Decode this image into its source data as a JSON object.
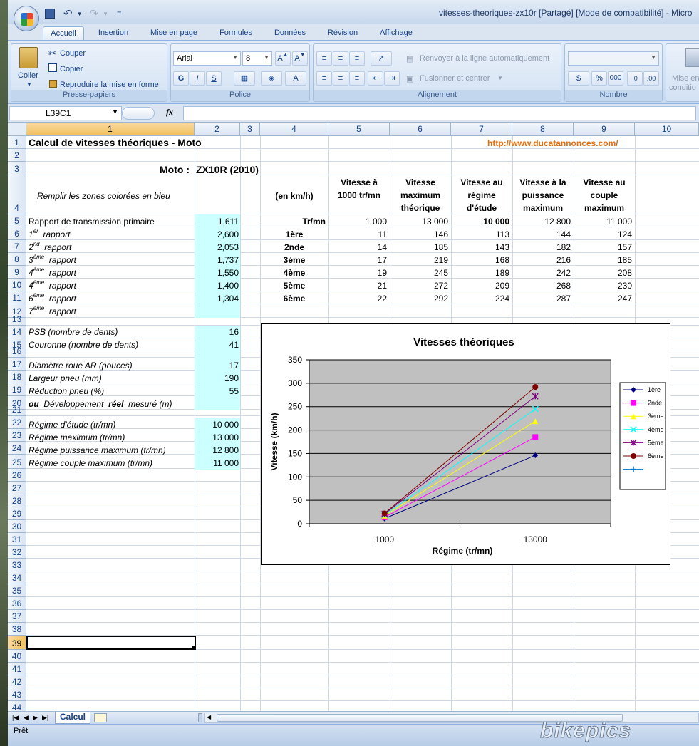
{
  "window": {
    "title": "vitesses-theoriques-zx10r  [Partagé]  [Mode de compatibilité] - Micro"
  },
  "qat": {
    "undo": "↶",
    "redo": "↷",
    "more": "="
  },
  "tabs": [
    "Accueil",
    "Insertion",
    "Mise en page",
    "Formules",
    "Données",
    "Révision",
    "Affichage"
  ],
  "ribbon": {
    "clipboard": {
      "paste": "Coller",
      "cut": "Couper",
      "copy": "Copier",
      "format_painter": "Reproduire la mise en forme",
      "caption": "Presse-papiers"
    },
    "font": {
      "name": "Arial",
      "size": "8",
      "bold": "G",
      "italic": "I",
      "underline": "S",
      "caption": "Police"
    },
    "alignment": {
      "wrap": "Renvoyer à la ligne automatiquement",
      "merge": "Fusionner et centrer",
      "caption": "Alignement"
    },
    "number": {
      "format": "",
      "percent": "%",
      "thousands": "000",
      "caption": "Nombre"
    },
    "styles": {
      "cond": "Mise en",
      "cond2": "conditio"
    }
  },
  "formula_bar": {
    "name_box": "L39C1",
    "fx": "fx",
    "value": ""
  },
  "columns": [
    "1",
    "2",
    "3",
    "4",
    "5",
    "6",
    "7",
    "8",
    "9",
    "10"
  ],
  "rows": [
    "1",
    "2",
    "3",
    "4",
    "5",
    "6",
    "7",
    "8",
    "9",
    "10",
    "11",
    "12",
    "13",
    "14",
    "15",
    "16",
    "17",
    "18",
    "19",
    "20",
    "21",
    "22",
    "23",
    "24",
    "25",
    "26",
    "27",
    "28",
    "29",
    "30",
    "31",
    "32",
    "33",
    "34",
    "35",
    "36",
    "37",
    "38",
    "39",
    "40",
    "41",
    "42",
    "43",
    "44"
  ],
  "sheet": {
    "title": "Calcul de vitesses théoriques - Moto",
    "url": "http://www.ducatannonces.com/",
    "moto_label": "Moto :",
    "moto_value": "ZX10R (2010)",
    "hint": "Remplir les zones colorées en bleu",
    "unit_header": "(en km/h)",
    "headers": [
      [
        "Vitesse à",
        "1000 tr/mn",
        ""
      ],
      [
        "Vitesse",
        "maximum",
        "théorique"
      ],
      [
        "Vitesse au",
        "régime",
        "d'étude"
      ],
      [
        "Vitesse à la",
        "puissance",
        "maximum"
      ],
      [
        "Vitesse au",
        "couple",
        "maximum"
      ]
    ],
    "trmn_label": "Tr/mn",
    "trmn_values": [
      "1 000",
      "13 000",
      "10 000",
      "12 800",
      "11 000"
    ],
    "primary_label": "Rapport de transmission primaire",
    "primary_value": "1,611",
    "gears": [
      {
        "n": "1",
        "sup": "er",
        "label": "rapport",
        "ratio": "2,600",
        "name": "1ère",
        "vals": [
          "11",
          "146",
          "113",
          "144",
          "124"
        ]
      },
      {
        "n": "2",
        "sup": "nd",
        "label": "rapport",
        "ratio": "2,053",
        "name": "2nde",
        "vals": [
          "14",
          "185",
          "143",
          "182",
          "157"
        ]
      },
      {
        "n": "3",
        "sup": "ème",
        "label": "rapport",
        "ratio": "1,737",
        "name": "3ème",
        "vals": [
          "17",
          "219",
          "168",
          "216",
          "185"
        ]
      },
      {
        "n": "4",
        "sup": "ème",
        "label": "rapport",
        "ratio": "1,550",
        "name": "4ème",
        "vals": [
          "19",
          "245",
          "189",
          "242",
          "208"
        ]
      },
      {
        "n": "4",
        "sup": "ème",
        "label": "rapport",
        "ratio": "1,400",
        "name": "5ème",
        "vals": [
          "21",
          "272",
          "209",
          "268",
          "230"
        ]
      },
      {
        "n": "6",
        "sup": "ème",
        "label": "rapport",
        "ratio": "1,304",
        "name": "6ème",
        "vals": [
          "22",
          "292",
          "224",
          "287",
          "247"
        ]
      },
      {
        "n": "7",
        "sup": "ème",
        "label": "rapport",
        "ratio": "",
        "name": "",
        "vals": [
          "",
          "",
          "",
          "",
          ""
        ]
      }
    ],
    "psb_label": "PSB (nombre de dents)",
    "psb_value": "16",
    "couronne_label": "Couronne (nombre de dents)",
    "couronne_value": "41",
    "diam_label": "Diamètre roue AR (pouces)",
    "diam_value": "17",
    "largeur_label": "Largeur pneu (mm)",
    "largeur_value": "190",
    "reduction_label": "Réduction pneu (%)",
    "reduction_value": "55",
    "dev_ou": "ou",
    "dev_label1": "Développement",
    "dev_reel": "réel",
    "dev_label2": "mesuré (m)",
    "regime_etude_label": "Régime d'étude (tr/mn)",
    "regime_etude_value": "10 000",
    "regime_max_label": "Régime maximum (tr/mn)",
    "regime_max_value": "13 000",
    "regime_puis_label": "Régime puissance maximum (tr/mn)",
    "regime_puis_value": "12 800",
    "regime_couple_label": "Régime couple maximum (tr/mn)",
    "regime_couple_value": "11 000"
  },
  "chart_data": {
    "type": "line",
    "title": "Vitesses théoriques",
    "xlabel": "Régime (tr/mn)",
    "ylabel": "Vitesse (km/h)",
    "categories": [
      "1000",
      "13000"
    ],
    "ylim": [
      0,
      350
    ],
    "yticks": [
      "0",
      "50",
      "100",
      "150",
      "200",
      "250",
      "300",
      "350"
    ],
    "grid": true,
    "legend_position": "right",
    "series": [
      {
        "name": "1ère",
        "values": [
          11,
          146
        ],
        "color": "#000080",
        "marker": "diamond"
      },
      {
        "name": "2nde",
        "values": [
          14,
          185
        ],
        "color": "#ff00ff",
        "marker": "square"
      },
      {
        "name": "3ème",
        "values": [
          17,
          219
        ],
        "color": "#ffff00",
        "marker": "triangle"
      },
      {
        "name": "4ème",
        "values": [
          19,
          245
        ],
        "color": "#00ffff",
        "marker": "x"
      },
      {
        "name": "5ème",
        "values": [
          21,
          272
        ],
        "color": "#800080",
        "marker": "star"
      },
      {
        "name": "6ème",
        "values": [
          22,
          292
        ],
        "color": "#800000",
        "marker": "circle"
      },
      {
        "name": "",
        "values": [
          null,
          null
        ],
        "color": "#0070c0",
        "marker": "plus"
      }
    ]
  },
  "sheet_tabs": {
    "active": "Calcul"
  },
  "status": {
    "text": "Prêt"
  },
  "watermark": "bikepics"
}
